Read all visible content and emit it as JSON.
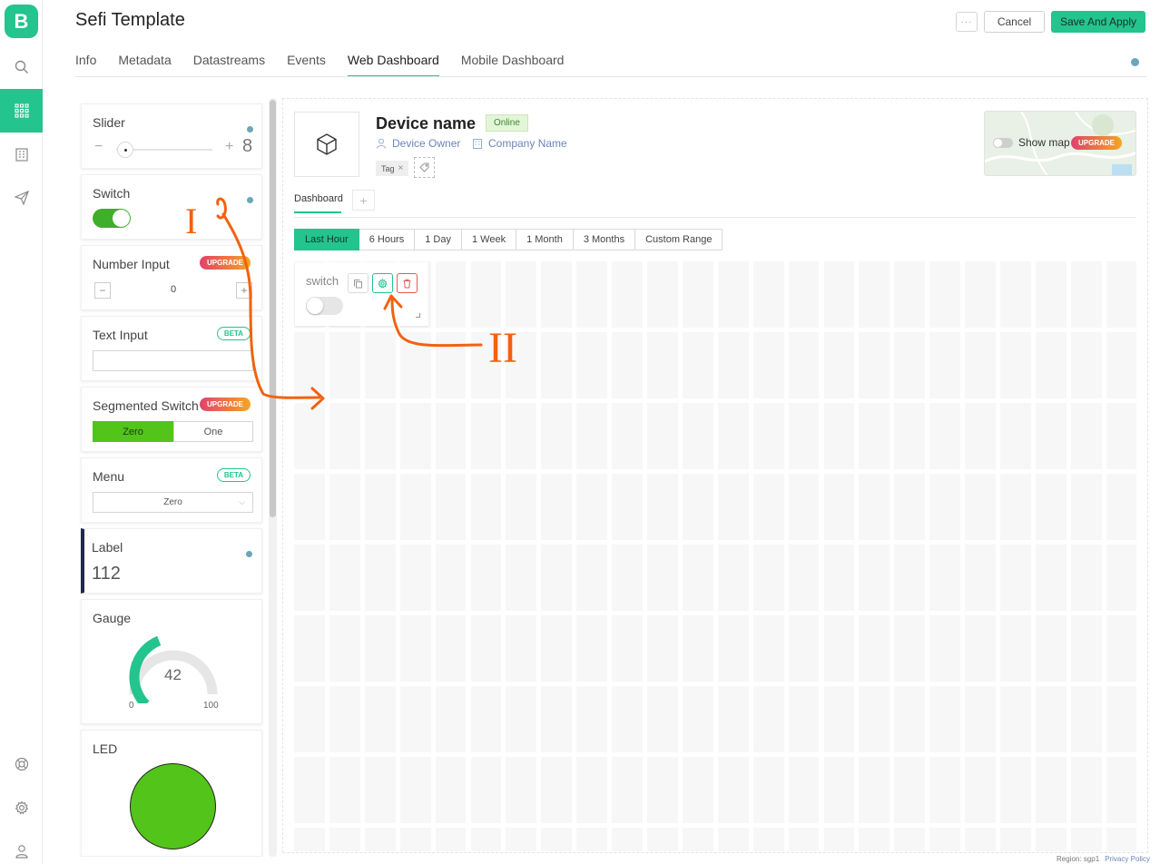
{
  "app": {
    "logo_letter": "B",
    "title": "Sefi Template",
    "actions": {
      "more": "···",
      "cancel": "Cancel",
      "save": "Save And Apply"
    }
  },
  "tabs": [
    {
      "label": "Info"
    },
    {
      "label": "Metadata"
    },
    {
      "label": "Datastreams"
    },
    {
      "label": "Events"
    },
    {
      "label": "Web Dashboard",
      "active": true
    },
    {
      "label": "Mobile Dashboard"
    }
  ],
  "rail_icons": [
    "search-icon",
    "grid-icon",
    "building-icon",
    "send-icon",
    "help-icon",
    "gear-icon",
    "user-icon"
  ],
  "widgets": {
    "slider": {
      "label": "Slider",
      "value": "8",
      "minus": "−",
      "plus": "+"
    },
    "switch": {
      "label": "Switch"
    },
    "number_input": {
      "label": "Number Input",
      "badge": "UPGRADE",
      "value": "0"
    },
    "text_input": {
      "label": "Text Input",
      "badge": "BETA",
      "value": ""
    },
    "segmented": {
      "label": "Segmented Switch",
      "badge": "UPGRADE",
      "options": [
        "Zero",
        "One"
      ]
    },
    "menu": {
      "label": "Menu",
      "badge": "BETA",
      "selected": "Zero"
    },
    "label_widget": {
      "label": "Label",
      "value": "112"
    },
    "gauge": {
      "label": "Gauge",
      "value": "42",
      "min": "0",
      "max": "100",
      "level": 0.42
    },
    "led": {
      "label": "LED"
    }
  },
  "device": {
    "name": "Device name",
    "status": "Online",
    "owner": "Device Owner",
    "company": "Company Name",
    "tag": "Tag",
    "show_map": "Show map",
    "map_badge": "UPGRADE"
  },
  "dashboard": {
    "tab": "Dashboard",
    "add": "+",
    "ranges": [
      "Last Hour",
      "6 Hours",
      "1 Day",
      "1 Week",
      "1 Month",
      "3 Months",
      "Custom Range"
    ],
    "active_range": "Last Hour",
    "placed_widget": {
      "label": "switch"
    }
  },
  "annotations": {
    "one": "I",
    "two": "II"
  },
  "footer": {
    "region": "Region: sgp1",
    "privacy": "Privacy Policy"
  },
  "colors": {
    "accent": "#23c48e",
    "led": "#52c41a",
    "annotation": "#f2620f",
    "danger": "#e25a5a"
  }
}
